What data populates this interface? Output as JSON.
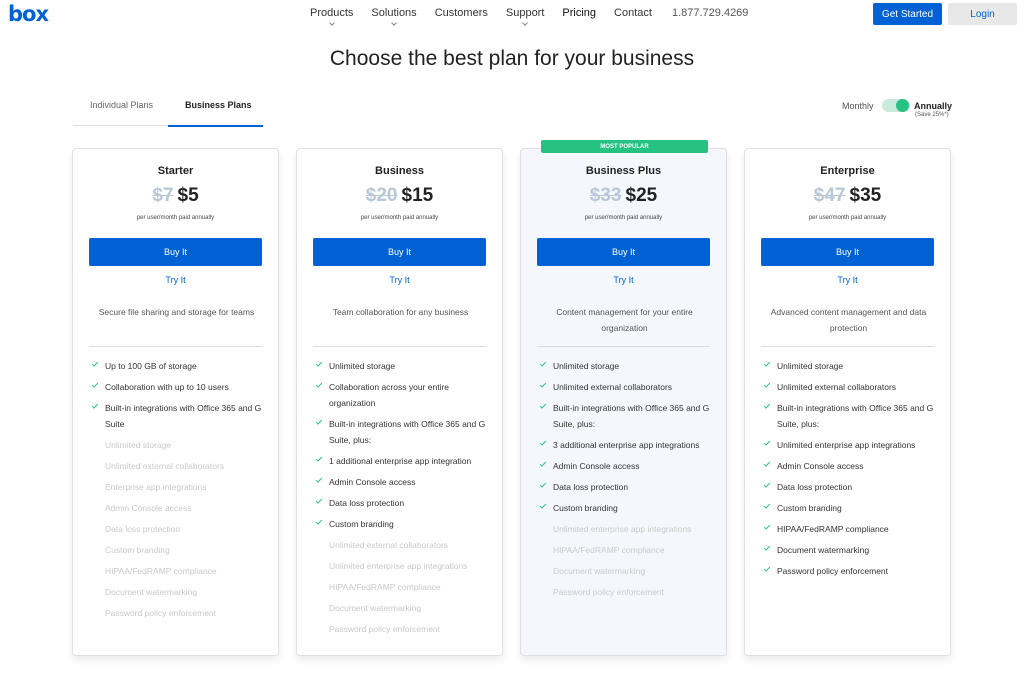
{
  "nav": {
    "logo": "box",
    "items": [
      {
        "label": "Products",
        "dropdown": true
      },
      {
        "label": "Solutions",
        "dropdown": true
      },
      {
        "label": "Customers",
        "dropdown": false
      },
      {
        "label": "Support",
        "dropdown": true
      },
      {
        "label": "Pricing",
        "dropdown": false
      },
      {
        "label": "Contact",
        "dropdown": false
      },
      {
        "label": "1.877.729.4269",
        "dropdown": false
      }
    ],
    "get_started": "Get Started",
    "login": "Login"
  },
  "title": "Choose the best plan for your business",
  "tabs": {
    "individual": "Individual Plans",
    "business": "Business Plans",
    "active": "business"
  },
  "billing": {
    "monthly": "Monthly",
    "annually": "Annually",
    "save": "(Save 25%*)",
    "selected": "annually"
  },
  "colors": {
    "accent": "#0061d5",
    "green": "#26c281"
  },
  "plans": [
    {
      "name": "Starter",
      "old_price": "$7",
      "price": "$5",
      "per": "per user/month paid annually",
      "buy": "Buy It",
      "try": "Try It",
      "description": "Secure file sharing and storage for teams",
      "features": [
        {
          "text": "Up to 100 GB of storage",
          "on": true
        },
        {
          "text": "Collaboration with up to 10 users",
          "on": true
        },
        {
          "text": "Built-in integrations with Office 365 and G Suite",
          "on": true
        },
        {
          "text": "Unlimited storage",
          "on": false
        },
        {
          "text": "Unlimited external collaborators",
          "on": false
        },
        {
          "text": "Enterprise app integrations",
          "on": false
        },
        {
          "text": "Admin Console access",
          "on": false
        },
        {
          "text": "Data loss protection",
          "on": false
        },
        {
          "text": "Custom branding",
          "on": false
        },
        {
          "text": "HIPAA/FedRAMP compliance",
          "on": false
        },
        {
          "text": "Document watermarking",
          "on": false
        },
        {
          "text": "Password policy enforcement",
          "on": false
        }
      ]
    },
    {
      "name": "Business",
      "old_price": "$20",
      "price": "$15",
      "per": "per user/month paid annually",
      "buy": "Buy It",
      "try": "Try It",
      "description": "Team collaboration for any business",
      "features": [
        {
          "text": "Unlimited storage",
          "on": true
        },
        {
          "text": "Collaboration across your entire organization",
          "on": true
        },
        {
          "text": "Built-in integrations with Office 365 and G Suite, plus:",
          "on": true
        },
        {
          "text": "1 additional enterprise app integration",
          "on": true
        },
        {
          "text": "Admin Console access",
          "on": true
        },
        {
          "text": "Data loss protection",
          "on": true
        },
        {
          "text": "Custom branding",
          "on": true
        },
        {
          "text": "Unlimited external collaborators",
          "on": false
        },
        {
          "text": "Unlimited enterprise app integrations",
          "on": false
        },
        {
          "text": "HIPAA/FedRAMP compliance",
          "on": false
        },
        {
          "text": "Document watermarking",
          "on": false
        },
        {
          "text": "Password policy enforcement",
          "on": false
        }
      ]
    },
    {
      "name": "Business Plus",
      "old_price": "$33",
      "price": "$25",
      "per": "per user/month paid annually",
      "buy": "Buy It",
      "try": "Try It",
      "description": "Content management for your entire organization",
      "badge": "MOST POPULAR",
      "features": [
        {
          "text": "Unlimited storage",
          "on": true
        },
        {
          "text": "Unlimited external collaborators",
          "on": true
        },
        {
          "text": "Built-in integrations with Office 365 and G Suite, plus:",
          "on": true
        },
        {
          "text": "3 additional enterprise app integrations",
          "on": true
        },
        {
          "text": "Admin Console access",
          "on": true
        },
        {
          "text": "Data loss protection",
          "on": true
        },
        {
          "text": "Custom branding",
          "on": true
        },
        {
          "text": "Unlimited enterprise app integrations",
          "on": false
        },
        {
          "text": "HIPAA/FedRAMP compliance",
          "on": false
        },
        {
          "text": "Document watermarking",
          "on": false
        },
        {
          "text": "Password policy enforcement",
          "on": false
        }
      ]
    },
    {
      "name": "Enterprise",
      "old_price": "$47",
      "price": "$35",
      "per": "per user/month paid annually",
      "buy": "Buy It",
      "try": "Try It",
      "description": "Advanced content management and data protection",
      "features": [
        {
          "text": "Unlimited storage",
          "on": true
        },
        {
          "text": "Unlimited external collaborators",
          "on": true
        },
        {
          "text": "Built-in integrations with Office 365 and G Suite, plus:",
          "on": true
        },
        {
          "text": "Unlimited enterprise app integrations",
          "on": true
        },
        {
          "text": "Admin Console access",
          "on": true
        },
        {
          "text": "Data loss protection",
          "on": true
        },
        {
          "text": "Custom branding",
          "on": true
        },
        {
          "text": "HIPAA/FedRAMP compliance",
          "on": true
        },
        {
          "text": "Document watermarking",
          "on": true
        },
        {
          "text": "Password policy enforcement",
          "on": true
        }
      ]
    }
  ]
}
